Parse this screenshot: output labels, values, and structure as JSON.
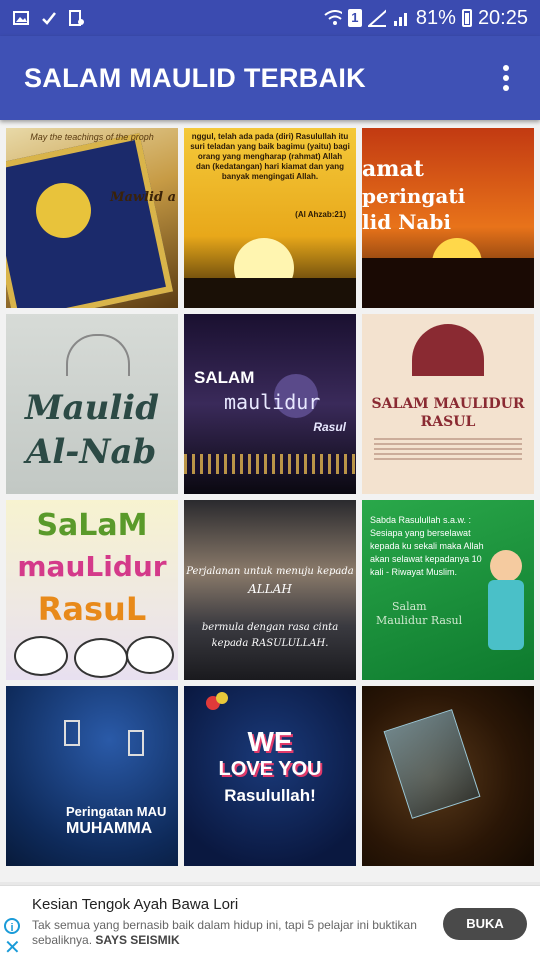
{
  "status_bar": {
    "battery": "81%",
    "time": "20:25",
    "sim_number": "1",
    "icons": [
      "gallery-icon",
      "check-icon",
      "settings-icon",
      "wifi-icon",
      "sim-icon",
      "signal-icon",
      "signal-icon",
      "battery-icon"
    ]
  },
  "app_bar": {
    "title": "SALAM MAULID TERBAIK",
    "menu_icon": "overflow-menu-icon"
  },
  "grid": {
    "tiles": [
      {
        "caption_top": "May the teachings of the proph",
        "caption_mid": "Mawlid a"
      },
      {
        "caption_top": "nggul, telah ada pada (diri) Rasulullah itu suri teladan yang baik bagimu (yaitu) bagi orang yang mengharap (rahmat) Allah dan (kedatangan) hari kiamat dan yang banyak mengingati Allah.",
        "caption_mid": "(Al Ahzab:21)"
      },
      {
        "caption_top": "amat",
        "caption_mid": "peringati",
        "caption_low": "lid Nabi"
      },
      {
        "caption_top": "Maulid",
        "caption_mid": "Al-Nab"
      },
      {
        "caption_top": "SALAM",
        "caption_mid": "maulidur",
        "caption_low": "Rasul"
      },
      {
        "caption_top": "SALAM MAULIDUR",
        "caption_mid": "RASUL"
      },
      {
        "caption_top": "SaLaM",
        "caption_mid": "mauLidur",
        "caption_low": "RasuL"
      },
      {
        "caption_top": "Perjalanan untuk menuju kepada",
        "caption_mid": "ALLAH",
        "caption_low": "bermula dengan rasa cinta kepada RASULULLAH."
      },
      {
        "caption_top": "Sabda Rasulullah s.a.w. : Sesiapa yang berselawat kepada ku sekali maka Allah akan selawat kepadanya 10 kali - Riwayat Muslim.",
        "caption_mid": "Salam",
        "caption_low": "Maulidur Rasul"
      },
      {
        "caption_top": "Peringatan MAU",
        "caption_mid": "MUHAMMA"
      },
      {
        "caption_top": "WE",
        "caption_mid": "LOVE YOU",
        "caption_low": "Rasulullah!"
      },
      {
        "caption_top": ""
      }
    ]
  },
  "ad": {
    "title": "Kesian Tengok Ayah Bawa Lori",
    "body": "Tak semua yang bernasib baik dalam hidup ini, tapi 5 pelajar ini buktikan sebaliknya.",
    "source": "SAYS SEISMIK",
    "button": "BUKA",
    "info_icon": "i",
    "close_icon": "✕"
  },
  "colors": {
    "app_bar": "#3f51b5",
    "status_bar": "#3b4bb0",
    "ad_button": "#4a4a4a",
    "ad_icon": "#1a9bd8"
  }
}
